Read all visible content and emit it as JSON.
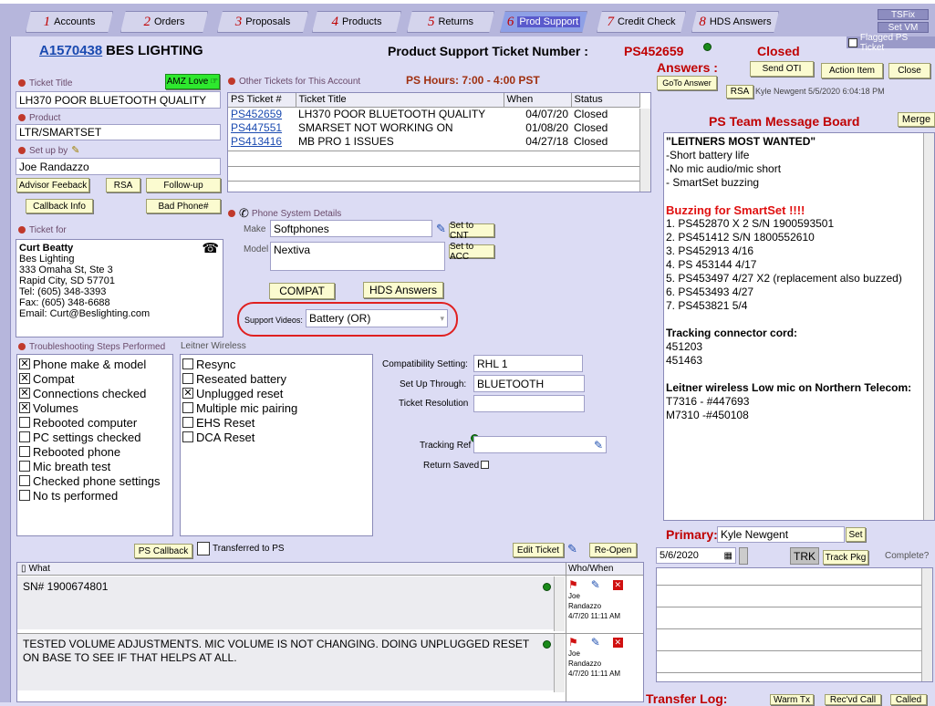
{
  "tabs": [
    {
      "num": "1",
      "label": "Accounts"
    },
    {
      "num": "2",
      "label": "Orders"
    },
    {
      "num": "3",
      "label": "Proposals"
    },
    {
      "num": "4",
      "label": "Products"
    },
    {
      "num": "5",
      "label": "Returns"
    },
    {
      "num": "6",
      "label": "Prod Support"
    },
    {
      "num": "7",
      "label": "Credit Check"
    },
    {
      "num": "8",
      "label": "HDS Answers"
    }
  ],
  "top_buttons": {
    "tsfix": "TSFix",
    "setvm": "Set VM",
    "flagged": "Flagged PS Ticket"
  },
  "header": {
    "account_id": "A1570438",
    "account_name": "BES LIGHTING",
    "ticket_label": "Product Support Ticket Number :",
    "ticket_number": "PS452659",
    "status": "Closed",
    "answers_label": "Answers :"
  },
  "ticket": {
    "title_label": "Ticket Title",
    "title_value": "LH370 POOR BLUETOOTH QUALITY",
    "amz_button": "AMZ Love",
    "product_label": "Product",
    "product_value": "LTR/SMARTSET",
    "setup_label": "Set up by",
    "setup_value": "Joe Randazzo",
    "advisor_feedback": "Advisor Feeback",
    "rsa": "RSA",
    "follow_up": "Follow-up",
    "callback_info": "Callback Info",
    "bad_phone": "Bad Phone#",
    "ticket_for_label": "Ticket for",
    "contact": {
      "name": "Curt Beatty",
      "company": "Bes Lighting",
      "street": "333 Omaha St, Ste 3",
      "city": "Rapid City, SD 57701",
      "tel": "Tel: (605) 348-3393",
      "fax": "Fax: (605) 348-6688",
      "email": "Email: Curt@Beslighting.com"
    }
  },
  "other_tickets": {
    "label": "Other Tickets for This Account",
    "hours": "PS Hours: 7:00 - 4:00 PST",
    "columns": [
      "PS Ticket #",
      "Ticket Title",
      "When",
      "Status"
    ],
    "rows": [
      {
        "id": "PS452659",
        "title": "LH370 POOR BLUETOOTH QUALITY",
        "when": "04/07/20",
        "status": "Closed"
      },
      {
        "id": "PS447551",
        "title": "SMARSET NOT WORKING ON",
        "when": "01/08/20",
        "status": "Closed"
      },
      {
        "id": "PS413416",
        "title": "MB PRO 1 ISSUES",
        "when": "04/27/18",
        "status": "Closed"
      }
    ]
  },
  "phone_system": {
    "label": "Phone System Details",
    "make_label": "Make",
    "make_value": "Softphones",
    "set_cnt": "Set to CNT",
    "model_label": "Model",
    "model_value": "Nextiva",
    "set_acc": "Set to ACC",
    "compat": "COMPAT",
    "hds_answers": "HDS Answers",
    "support_videos_label": "Support Videos:",
    "support_videos_value": "Battery (OR)"
  },
  "troubleshooting": {
    "label": "Troubleshooting Steps Performed",
    "items": [
      {
        "label": "Phone make & model",
        "checked": true
      },
      {
        "label": "Compat",
        "checked": true
      },
      {
        "label": "Connections checked",
        "checked": true
      },
      {
        "label": "Volumes",
        "checked": true
      },
      {
        "label": "Rebooted computer",
        "checked": false
      },
      {
        "label": "PC settings checked",
        "checked": false
      },
      {
        "label": "Rebooted phone",
        "checked": false
      },
      {
        "label": "Mic breath test",
        "checked": false
      },
      {
        "label": "Checked phone settings",
        "checked": false
      },
      {
        "label": "No ts performed",
        "checked": false
      }
    ]
  },
  "leitner": {
    "label": "Leitner Wireless",
    "items": [
      {
        "label": "Resync",
        "checked": false
      },
      {
        "label": "Reseated battery",
        "checked": false
      },
      {
        "label": "Unplugged reset",
        "checked": true
      },
      {
        "label": "Multiple mic pairing",
        "checked": false
      },
      {
        "label": "EHS Reset",
        "checked": false
      },
      {
        "label": "DCA Reset",
        "checked": false
      }
    ]
  },
  "settings": {
    "compat_label": "Compatibility Setting:",
    "compat_value": "RHL 1",
    "setup_label": "Set Up Through:",
    "setup_value": "BLUETOOTH",
    "resolution_label": "Ticket Resolution",
    "resolution_value": "",
    "tracking_label": "Tracking Ref",
    "return_saved_label": "Return Saved"
  },
  "actions": {
    "ps_callback": "PS Callback",
    "transferred": "Transferred to PS",
    "edit_ticket": "Edit Ticket",
    "reopen": "Re-Open"
  },
  "notes": {
    "col_what": "What",
    "col_who": "Who/When",
    "entries": [
      {
        "text": "SN# 1900674801",
        "who": "Joe",
        "who2": "Randazzo",
        "when": "4/7/20 11:11 AM"
      },
      {
        "text": "TESTED VOLUME ADJUSTMENTS. MIC VOLUME IS NOT CHANGING. DOING UNPLUGGED RESET ON BASE TO SEE IF THAT HELPS AT ALL.",
        "who": "Joe",
        "who2": "Randazzo",
        "when": "4/7/20 11:11 AM"
      }
    ]
  },
  "right": {
    "send_oti": "Send OTI",
    "action_item": "Action Item",
    "close": "Close",
    "goto_answer": "GoTo Answer",
    "rsa": "RSA",
    "rsa_info": "Kyle Newgent 5/5/2020 6:04:18 PM",
    "board_title": "PS Team Message Board",
    "merge": "Merge",
    "board_lines": [
      {
        "text": "\"LEITNERS MOST WANTED\"",
        "style": "bold"
      },
      {
        "text": "-Short battery life",
        "style": "normal"
      },
      {
        "text": "-No mic audio/mic short",
        "style": "normal"
      },
      {
        "text": "- SmartSet buzzing",
        "style": "normal"
      },
      {
        "text": "",
        "style": "normal"
      },
      {
        "text": "Buzzing for SmartSet !!!!",
        "style": "red"
      },
      {
        "text": "1. PS452870 X 2 S/N 1900593501",
        "style": "normal"
      },
      {
        "text": "2. PS451412 S/N 1800552610",
        "style": "normal"
      },
      {
        "text": "3. PS452913 4/16",
        "style": "normal"
      },
      {
        "text": "4. PS 453144 4/17",
        "style": "normal"
      },
      {
        "text": "5. PS453497 4/27 X2 (replacement also buzzed)",
        "style": "normal"
      },
      {
        "text": "6. PS453493 4/27",
        "style": "normal"
      },
      {
        "text": "7. PS453821 5/4",
        "style": "normal"
      },
      {
        "text": "",
        "style": "normal"
      },
      {
        "text": "Tracking connector cord:",
        "style": "bold"
      },
      {
        "text": "451203",
        "style": "normal"
      },
      {
        "text": "451463",
        "style": "normal"
      },
      {
        "text": "",
        "style": "normal"
      },
      {
        "text": "Leitner wireless Low mic on Northern Telecom:",
        "style": "bold"
      },
      {
        "text": "T7316 - #447693",
        "style": "normal"
      },
      {
        "text": "M7310 -#450108",
        "style": "normal"
      }
    ],
    "primary_label": "Primary:",
    "primary_value": "Kyle Newgent",
    "set": "Set",
    "date_value": "5/6/2020",
    "trk": "TRK",
    "track_pkg": "Track Pkg",
    "complete": "Complete?",
    "transfer_log": "Transfer Log:",
    "warm_tx": "Warm Tx",
    "recvd_call": "Rec'vd Call",
    "called": "Called"
  }
}
